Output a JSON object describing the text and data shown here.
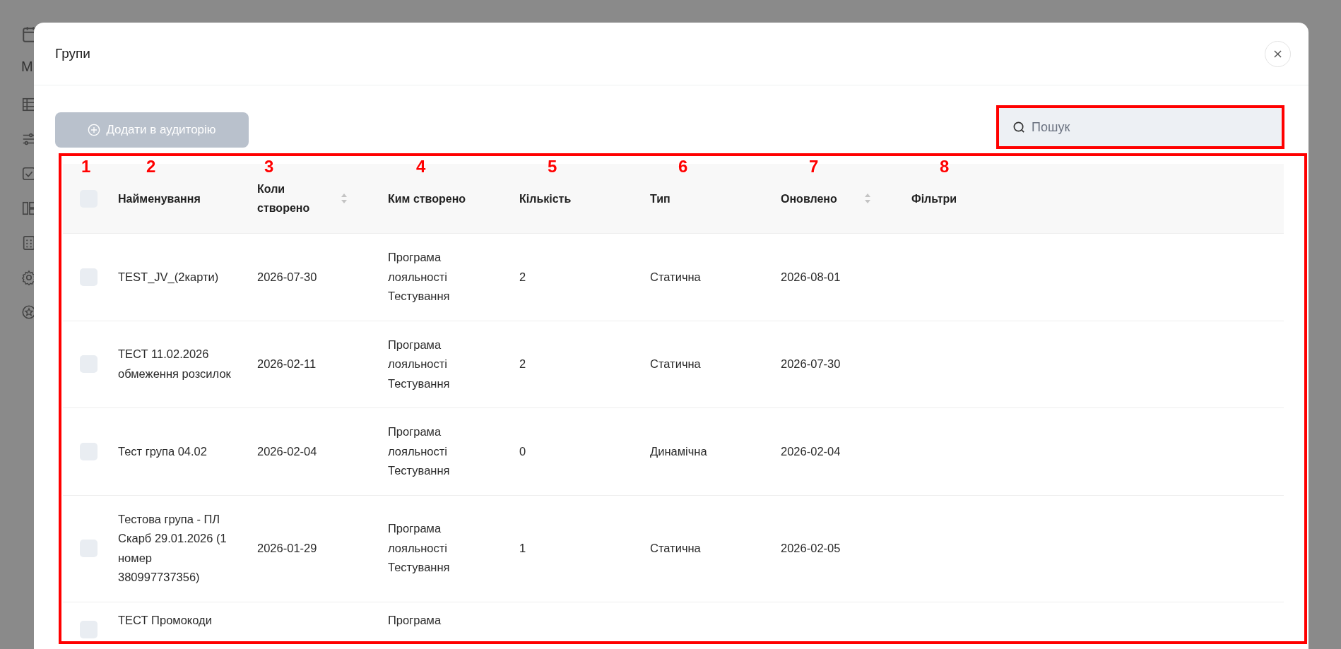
{
  "sidebar": {
    "letter": "М"
  },
  "dialog": {
    "title": "Групи"
  },
  "toolbar": {
    "add_button": {
      "label": "Додати в аудиторію",
      "disabled": true
    },
    "search": {
      "placeholder": "Пошук",
      "highlighted": true
    }
  },
  "table": {
    "highlighted": true,
    "select_column": {
      "number": "1",
      "checked": false
    },
    "columns": [
      {
        "label": "Найменування",
        "number": "2",
        "sortable": false
      },
      {
        "label": "Коли створено",
        "number": "3",
        "sortable": true
      },
      {
        "label": "Ким створено",
        "number": "4",
        "sortable": false
      },
      {
        "label": "Кількість",
        "number": "5",
        "sortable": false
      },
      {
        "label": "Тип",
        "number": "6",
        "sortable": false
      },
      {
        "label": "Оновлено",
        "number": "7",
        "sortable": true
      },
      {
        "label": "Фільтри",
        "number": "8",
        "sortable": false
      }
    ],
    "rows": [
      {
        "checked": false,
        "cells": [
          "TEST_JV_(2карти)",
          "2026-07-30",
          "Програма лояльності Тестування",
          "2",
          "Статична",
          "2026-08-01"
        ]
      },
      {
        "checked": false,
        "cells": [
          "ТЕСТ 11.02.2026 обмеження розсилок",
          "2026-02-11",
          "Програма лояльності Тестування",
          "2",
          "Статична",
          "2026-07-30"
        ]
      },
      {
        "checked": false,
        "cells": [
          "Тест група 04.02",
          "2026-02-04",
          "Програма лояльності Тестування",
          "0",
          "Динамічна",
          "2026-02-04"
        ]
      },
      {
        "checked": false,
        "cells": [
          "Тестова група - ПЛ Скарб 29.01.2026 (1 номер 380997737356)",
          "2026-01-29",
          "Програма лояльності Тестування",
          "1",
          "Статична",
          "2026-02-05"
        ]
      },
      {
        "checked": false,
        "cells": [
          "ТЕСТ Промокоди",
          "",
          "Програма"
        ]
      }
    ]
  }
}
